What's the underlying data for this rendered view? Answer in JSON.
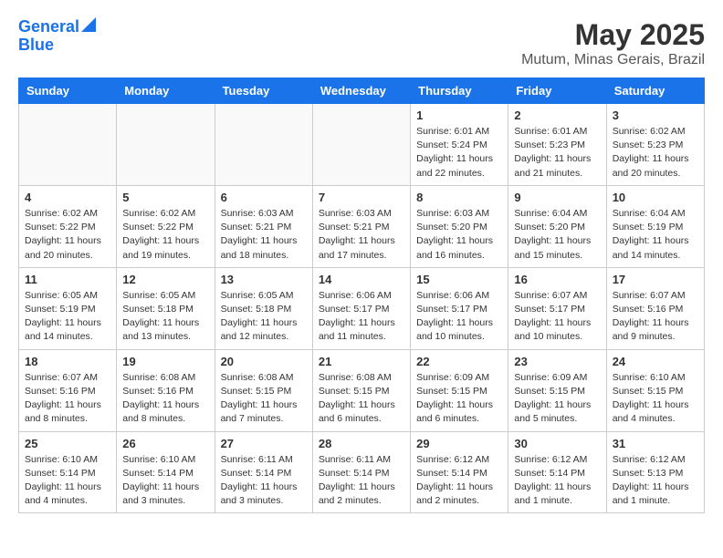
{
  "header": {
    "logo_line1": "General",
    "logo_line2": "Blue",
    "month": "May 2025",
    "location": "Mutum, Minas Gerais, Brazil"
  },
  "days_of_week": [
    "Sunday",
    "Monday",
    "Tuesday",
    "Wednesday",
    "Thursday",
    "Friday",
    "Saturday"
  ],
  "weeks": [
    [
      {
        "day": "",
        "empty": true
      },
      {
        "day": "",
        "empty": true
      },
      {
        "day": "",
        "empty": true
      },
      {
        "day": "",
        "empty": true
      },
      {
        "day": "1",
        "info": "Sunrise: 6:01 AM\nSunset: 5:24 PM\nDaylight: 11 hours\nand 22 minutes."
      },
      {
        "day": "2",
        "info": "Sunrise: 6:01 AM\nSunset: 5:23 PM\nDaylight: 11 hours\nand 21 minutes."
      },
      {
        "day": "3",
        "info": "Sunrise: 6:02 AM\nSunset: 5:23 PM\nDaylight: 11 hours\nand 20 minutes."
      }
    ],
    [
      {
        "day": "4",
        "info": "Sunrise: 6:02 AM\nSunset: 5:22 PM\nDaylight: 11 hours\nand 20 minutes."
      },
      {
        "day": "5",
        "info": "Sunrise: 6:02 AM\nSunset: 5:22 PM\nDaylight: 11 hours\nand 19 minutes."
      },
      {
        "day": "6",
        "info": "Sunrise: 6:03 AM\nSunset: 5:21 PM\nDaylight: 11 hours\nand 18 minutes."
      },
      {
        "day": "7",
        "info": "Sunrise: 6:03 AM\nSunset: 5:21 PM\nDaylight: 11 hours\nand 17 minutes."
      },
      {
        "day": "8",
        "info": "Sunrise: 6:03 AM\nSunset: 5:20 PM\nDaylight: 11 hours\nand 16 minutes."
      },
      {
        "day": "9",
        "info": "Sunrise: 6:04 AM\nSunset: 5:20 PM\nDaylight: 11 hours\nand 15 minutes."
      },
      {
        "day": "10",
        "info": "Sunrise: 6:04 AM\nSunset: 5:19 PM\nDaylight: 11 hours\nand 14 minutes."
      }
    ],
    [
      {
        "day": "11",
        "info": "Sunrise: 6:05 AM\nSunset: 5:19 PM\nDaylight: 11 hours\nand 14 minutes."
      },
      {
        "day": "12",
        "info": "Sunrise: 6:05 AM\nSunset: 5:18 PM\nDaylight: 11 hours\nand 13 minutes."
      },
      {
        "day": "13",
        "info": "Sunrise: 6:05 AM\nSunset: 5:18 PM\nDaylight: 11 hours\nand 12 minutes."
      },
      {
        "day": "14",
        "info": "Sunrise: 6:06 AM\nSunset: 5:17 PM\nDaylight: 11 hours\nand 11 minutes."
      },
      {
        "day": "15",
        "info": "Sunrise: 6:06 AM\nSunset: 5:17 PM\nDaylight: 11 hours\nand 10 minutes."
      },
      {
        "day": "16",
        "info": "Sunrise: 6:07 AM\nSunset: 5:17 PM\nDaylight: 11 hours\nand 10 minutes."
      },
      {
        "day": "17",
        "info": "Sunrise: 6:07 AM\nSunset: 5:16 PM\nDaylight: 11 hours\nand 9 minutes."
      }
    ],
    [
      {
        "day": "18",
        "info": "Sunrise: 6:07 AM\nSunset: 5:16 PM\nDaylight: 11 hours\nand 8 minutes."
      },
      {
        "day": "19",
        "info": "Sunrise: 6:08 AM\nSunset: 5:16 PM\nDaylight: 11 hours\nand 8 minutes."
      },
      {
        "day": "20",
        "info": "Sunrise: 6:08 AM\nSunset: 5:15 PM\nDaylight: 11 hours\nand 7 minutes."
      },
      {
        "day": "21",
        "info": "Sunrise: 6:08 AM\nSunset: 5:15 PM\nDaylight: 11 hours\nand 6 minutes."
      },
      {
        "day": "22",
        "info": "Sunrise: 6:09 AM\nSunset: 5:15 PM\nDaylight: 11 hours\nand 6 minutes."
      },
      {
        "day": "23",
        "info": "Sunrise: 6:09 AM\nSunset: 5:15 PM\nDaylight: 11 hours\nand 5 minutes."
      },
      {
        "day": "24",
        "info": "Sunrise: 6:10 AM\nSunset: 5:15 PM\nDaylight: 11 hours\nand 4 minutes."
      }
    ],
    [
      {
        "day": "25",
        "info": "Sunrise: 6:10 AM\nSunset: 5:14 PM\nDaylight: 11 hours\nand 4 minutes."
      },
      {
        "day": "26",
        "info": "Sunrise: 6:10 AM\nSunset: 5:14 PM\nDaylight: 11 hours\nand 3 minutes."
      },
      {
        "day": "27",
        "info": "Sunrise: 6:11 AM\nSunset: 5:14 PM\nDaylight: 11 hours\nand 3 minutes."
      },
      {
        "day": "28",
        "info": "Sunrise: 6:11 AM\nSunset: 5:14 PM\nDaylight: 11 hours\nand 2 minutes."
      },
      {
        "day": "29",
        "info": "Sunrise: 6:12 AM\nSunset: 5:14 PM\nDaylight: 11 hours\nand 2 minutes."
      },
      {
        "day": "30",
        "info": "Sunrise: 6:12 AM\nSunset: 5:14 PM\nDaylight: 11 hours\nand 1 minute."
      },
      {
        "day": "31",
        "info": "Sunrise: 6:12 AM\nSunset: 5:13 PM\nDaylight: 11 hours\nand 1 minute."
      }
    ]
  ]
}
